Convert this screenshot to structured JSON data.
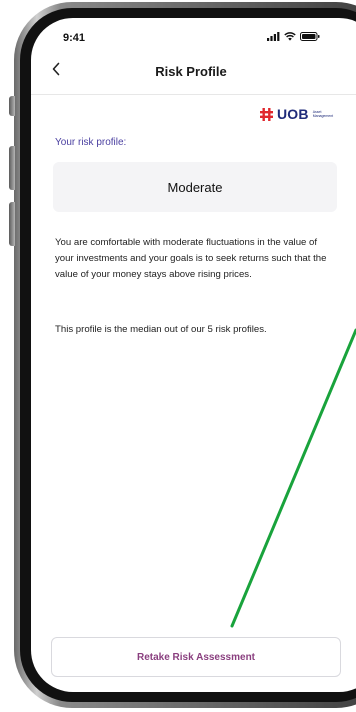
{
  "status_bar": {
    "time": "9:41",
    "icons": [
      "signal-icon",
      "wifi-icon",
      "battery-icon"
    ]
  },
  "nav": {
    "back_icon": "chevron-left-icon",
    "title": "Risk Profile"
  },
  "logo": {
    "brand": "UOB",
    "subtitle": "Asset Management"
  },
  "risk": {
    "heading": "Your risk profile:",
    "value": "Moderate",
    "description": "You are comfortable with moderate fluctuations in the value of your investments and your goals is to seek returns such that the value of your money stays above rising prices.",
    "note": "This profile is the median out of our 5 risk profiles."
  },
  "actions": {
    "retake_label": "Retake Risk Assessment"
  },
  "colors": {
    "accent_purple": "#4a3fa0",
    "button_text": "#8a3f7f",
    "uob_red": "#e0262c",
    "uob_blue": "#1f2b7a",
    "annotation_line": "#19a33c"
  }
}
